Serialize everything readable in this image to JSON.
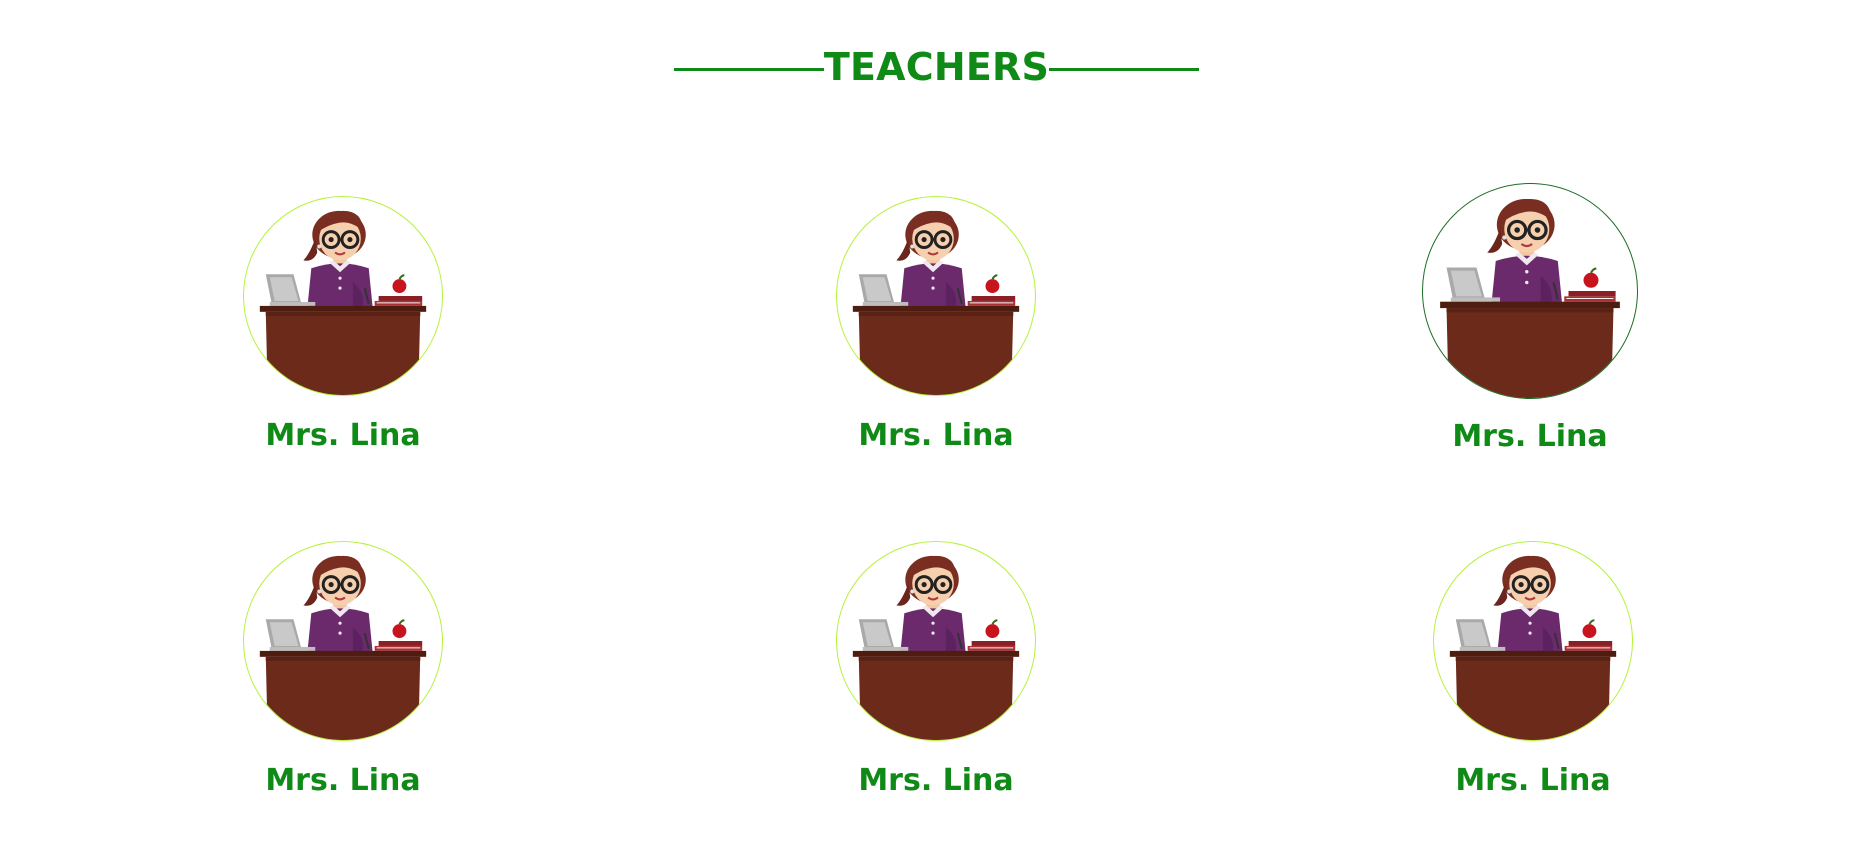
{
  "section": {
    "title": "TEACHERS"
  },
  "teachers": [
    {
      "name": "Mrs. Lina",
      "photo_icon": "teacher-at-desk-illustration"
    },
    {
      "name": "Mrs. Lina",
      "photo_icon": "teacher-at-desk-illustration"
    },
    {
      "name": "Mrs. Lina",
      "photo_icon": "teacher-at-desk-illustration"
    },
    {
      "name": "Mrs. Lina",
      "photo_icon": "teacher-at-desk-illustration"
    },
    {
      "name": "Mrs. Lina",
      "photo_icon": "teacher-at-desk-illustration"
    },
    {
      "name": "Mrs. Lina",
      "photo_icon": "teacher-at-desk-illustration"
    }
  ],
  "colors": {
    "heading": "#0f8a16",
    "name": "#0f8a16",
    "avatar_border": "#b5f23a",
    "avatar_border_hover": "#1d6d24",
    "desk": "#6b2a1a",
    "sweater": "#6b2a6b"
  }
}
